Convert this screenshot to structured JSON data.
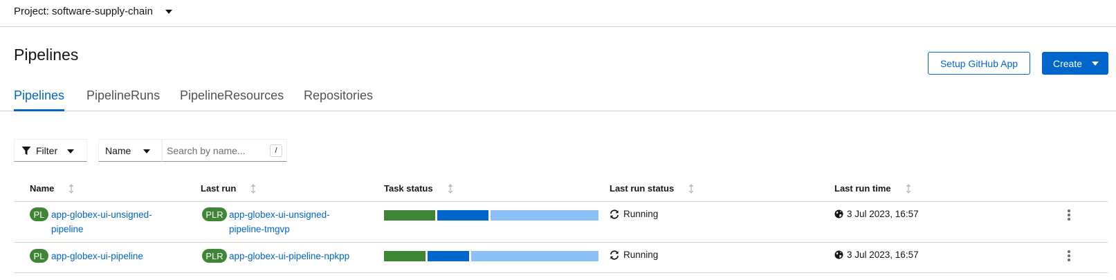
{
  "project": {
    "label": "Project: software-supply-chain"
  },
  "header": {
    "title": "Pipelines",
    "setup_github_label": "Setup GitHub App",
    "create_label": "Create"
  },
  "tabs": [
    {
      "label": "Pipelines",
      "active": true
    },
    {
      "label": "PipelineRuns",
      "active": false
    },
    {
      "label": "PipelineResources",
      "active": false
    },
    {
      "label": "Repositories",
      "active": false
    }
  ],
  "toolbar": {
    "filter_label": "Filter",
    "field_select": "Name",
    "search_placeholder": "Search by name...",
    "search_value": "",
    "shortcut_hint": "/"
  },
  "table": {
    "columns": [
      "Name",
      "Last run",
      "Task status",
      "Last run status",
      "Last run time"
    ],
    "rows": [
      {
        "name_badge": "PL",
        "name_lines": [
          "app-globex-ui-unsigned-",
          "pipeline"
        ],
        "run_badge": "PLR",
        "run_lines": [
          "app-globex-ui-unsigned-",
          "pipeline-tmgvp"
        ],
        "task_status": [
          {
            "state": "succeeded",
            "fraction": 0.245,
            "color": "#3e8635"
          },
          {
            "state": "running",
            "fraction": 0.245,
            "color": "#0066cc"
          },
          {
            "state": "pending",
            "fraction": 0.51,
            "color": "#8bc1f7"
          }
        ],
        "status": "Running",
        "time": "3 Jul 2023, 16:57"
      },
      {
        "name_badge": "PL",
        "name_lines": [
          "app-globex-ui-pipeline"
        ],
        "run_badge": "PLR",
        "run_lines": [
          "app-globex-ui-pipeline-npkpp"
        ],
        "task_status": [
          {
            "state": "succeeded",
            "fraction": 0.197,
            "color": "#3e8635"
          },
          {
            "state": "running",
            "fraction": 0.197,
            "color": "#0066cc"
          },
          {
            "state": "pending",
            "fraction": 0.606,
            "color": "#8bc1f7"
          }
        ],
        "status": "Running",
        "time": "3 Jul 2023, 16:57"
      }
    ]
  },
  "icons": {
    "project_dropdown": "caret-down-icon",
    "filter": "filter-icon",
    "sort": "sort-icon",
    "status": "sync-icon",
    "time": "globe-icon",
    "row_actions": "kebab-icon"
  },
  "colors": {
    "accent": "#0066cc",
    "success": "#3e8635",
    "pending": "#8bc1f7",
    "border": "#d2d2d2"
  }
}
